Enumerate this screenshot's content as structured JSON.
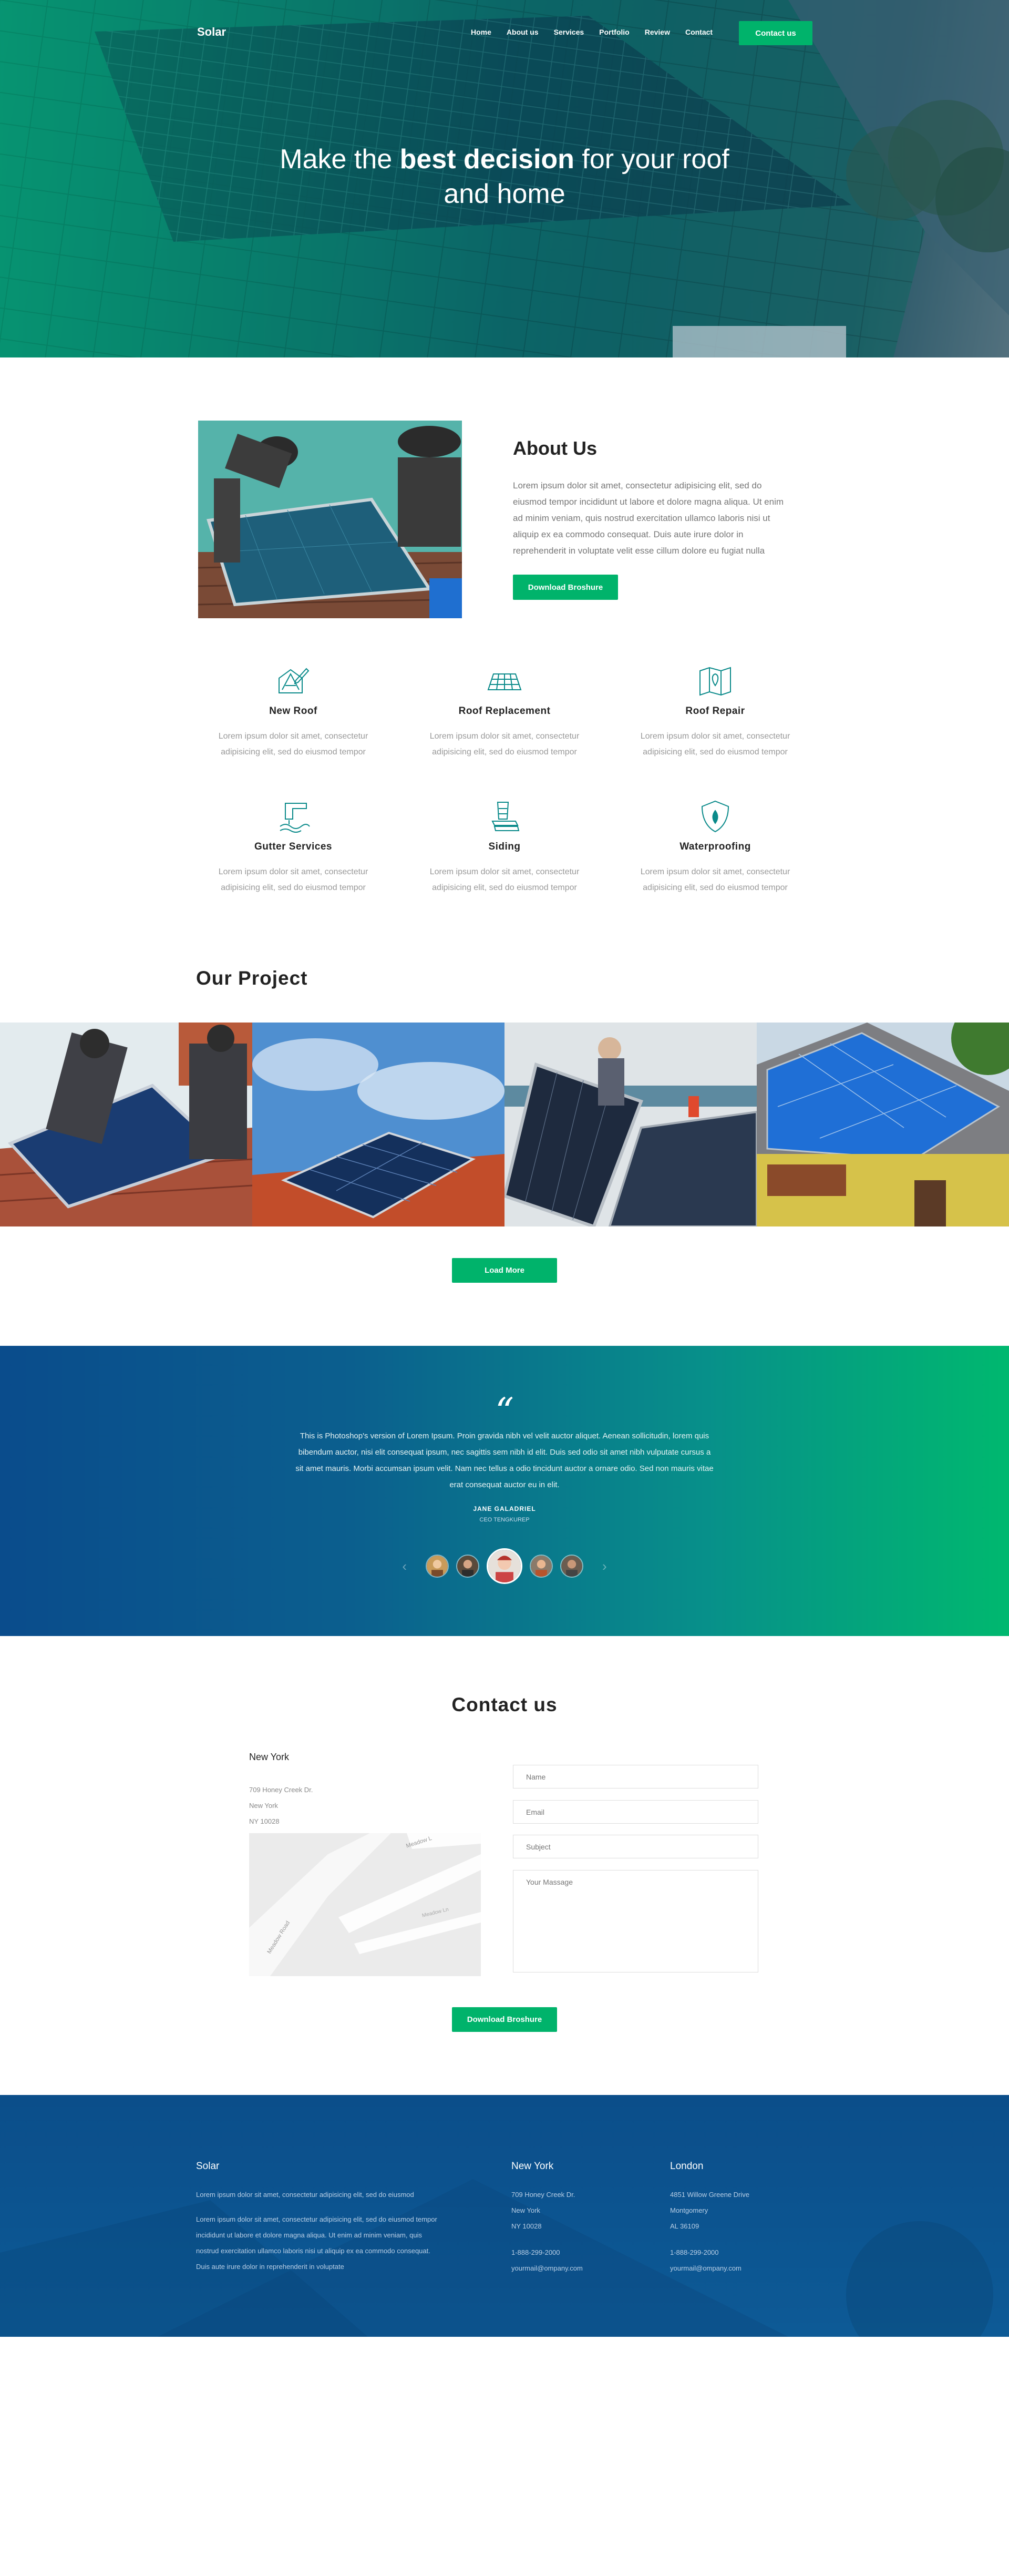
{
  "nav": {
    "logo": "Solar",
    "items": [
      "Home",
      "About us",
      "Services",
      "Portfolio",
      "Review",
      "Contact"
    ],
    "cta": "Contact us"
  },
  "hero": {
    "title_pre": "Make the ",
    "title_bold": "best decision",
    "title_post": " for your roof",
    "title_line2": "and home"
  },
  "about": {
    "title": "About Us",
    "text": "Lorem ipsum dolor sit amet, consectetur adipisicing elit, sed do eiusmod tempor incididunt ut labore et dolore magna aliqua. Ut enim ad minim veniam, quis nostrud exercitation ullamco laboris nisi ut aliquip ex ea commodo consequat. Duis aute irure dolor in reprehenderit in voluptate velit esse cillum dolore eu fugiat nulla",
    "button": "Download Broshure"
  },
  "services": [
    {
      "title": "New Roof",
      "icon": "roof-pencil-icon",
      "text": "Lorem ipsum dolor sit amet, consectetur adipisicing elit, sed do eiusmod tempor"
    },
    {
      "title": "Roof Replacement",
      "icon": "roof-tiles-icon",
      "text": "Lorem ipsum dolor sit amet, consectetur adipisicing elit, sed do eiusmod tempor"
    },
    {
      "title": "Roof Repair",
      "icon": "map-pin-icon",
      "text": "Lorem ipsum dolor sit amet, consectetur adipisicing elit, sed do eiusmod tempor"
    },
    {
      "title": "Gutter Services",
      "icon": "gutter-icon",
      "text": "Lorem ipsum dolor sit amet, consectetur adipisicing elit, sed do eiusmod tempor"
    },
    {
      "title": "Siding",
      "icon": "siding-icon",
      "text": "Lorem ipsum dolor sit amet, consectetur adipisicing elit, sed do eiusmod tempor"
    },
    {
      "title": "Waterproofing",
      "icon": "shield-drop-icon",
      "text": "Lorem ipsum dolor sit amet, consectetur adipisicing elit, sed do eiusmod tempor"
    }
  ],
  "projects": {
    "title": "Our Project",
    "button": "Load More"
  },
  "testimonial": {
    "quote": "This is Photoshop's version  of Lorem Ipsum. Proin gravida nibh vel velit auctor aliquet. Aenean sollicitudin, lorem quis bibendum auctor, nisi elit consequat ipsum, nec sagittis sem nibh id elit. Duis sed odio sit amet nibh vulputate cursus a sit amet mauris. Morbi accumsan ipsum velit. Nam nec tellus a odio tincidunt auctor a ornare odio. Sed non  mauris vitae erat consequat auctor eu in elit.",
    "name": "JANE GALADRIEL",
    "role": "CEO TENGKUREP"
  },
  "contact": {
    "title": "Contact us",
    "city": "New York",
    "address": [
      "709 Honey Creek Dr.",
      "New York",
      "NY 10028"
    ],
    "placeholders": {
      "name": "Name",
      "email": "Email",
      "subject": "Subject",
      "message": "Your Massage"
    },
    "map_streets": [
      "Meadow L",
      "Meadow Road",
      "Meadow Ln"
    ],
    "button": "Download Broshure"
  },
  "footer": {
    "col1": {
      "title": "Solar",
      "p1": "Lorem ipsum dolor sit amet, consectetur adipisicing elit, sed do eiusmod",
      "p2": "Lorem ipsum dolor sit amet, consectetur adipisicing elit, sed do eiusmod tempor incididunt ut labore et dolore magna aliqua. Ut enim ad minim veniam, quis nostrud exercitation ullamco laboris nisi ut aliquip ex ea commodo consequat. Duis aute irure dolor in reprehenderit in voluptate"
    },
    "col2": {
      "title": "New York",
      "address": [
        "709 Honey Creek Dr.",
        "New York",
        "NY 10028"
      ],
      "phone": "1-888-299-2000",
      "email": "yourmail@ompany.com"
    },
    "col3": {
      "title": "London",
      "address": [
        "4851 Willow Greene Drive",
        "Montgomery",
        "AL 36109"
      ],
      "phone": "1-888-299-2000",
      "email": "yourmail@ompany.com"
    }
  },
  "colors": {
    "accent": "#00b36b",
    "blue": "#0b4e8a"
  }
}
